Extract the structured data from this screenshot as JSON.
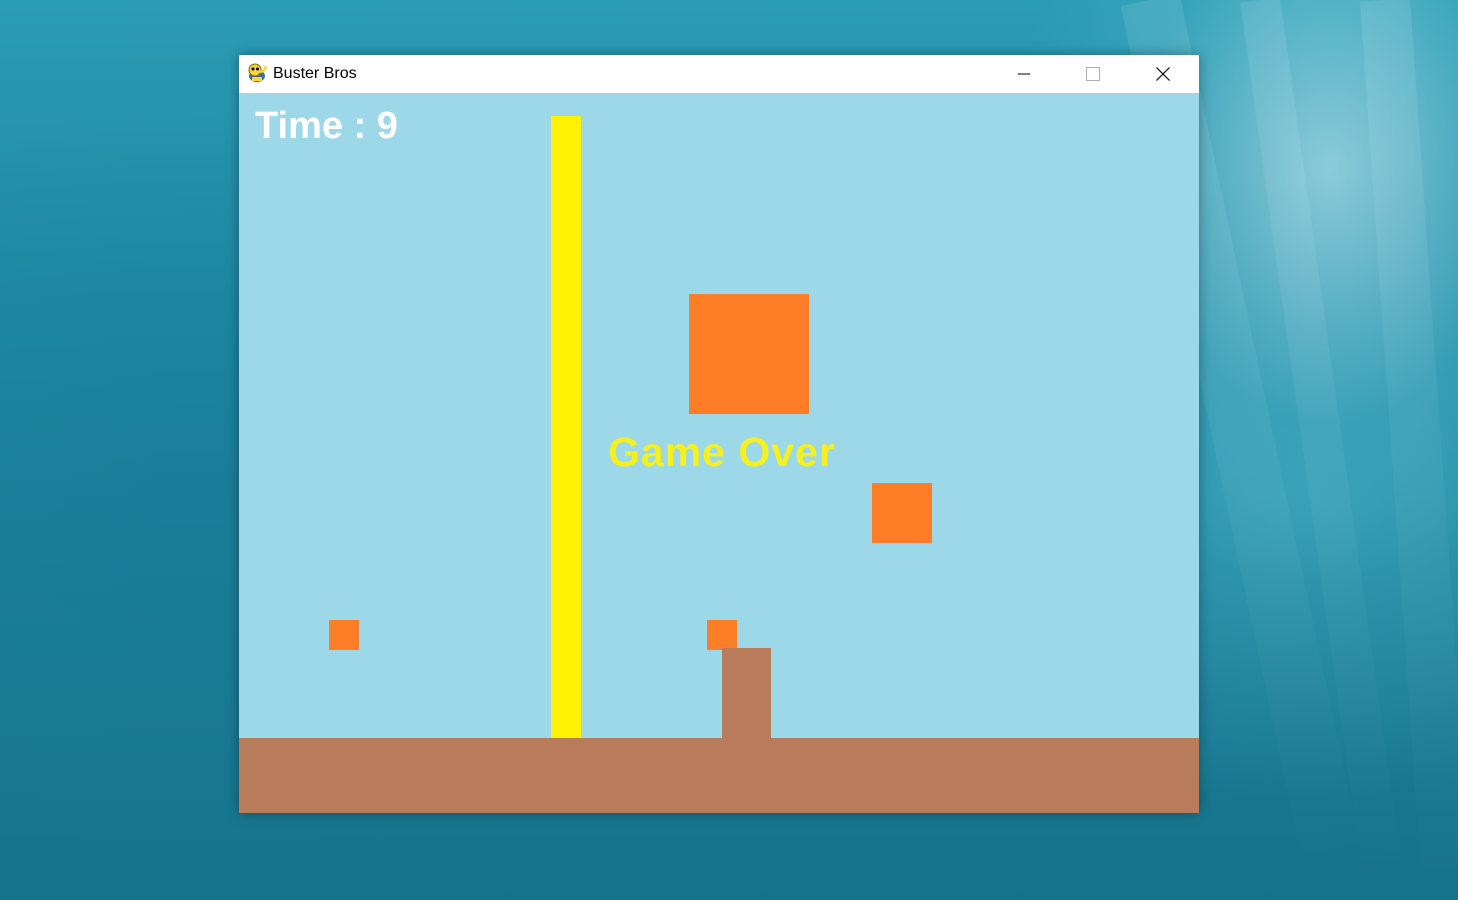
{
  "window": {
    "title": "Buster Bros",
    "app_icon": "pygame-snake-icon",
    "controls": {
      "minimize_icon": "minimize-icon",
      "maximize_icon": "maximize-icon",
      "close_icon": "close-icon"
    }
  },
  "game": {
    "time_label": "Time : 9",
    "game_over_label": "Game Over",
    "colors": {
      "sky": "#9dd8e9",
      "ground": "#b97c5a",
      "player": "#b97c5a",
      "harpoon": "#fff200",
      "ball": "#fd7e26",
      "time_text": "#ffffff",
      "game_over_text": "#f5f01e"
    }
  }
}
